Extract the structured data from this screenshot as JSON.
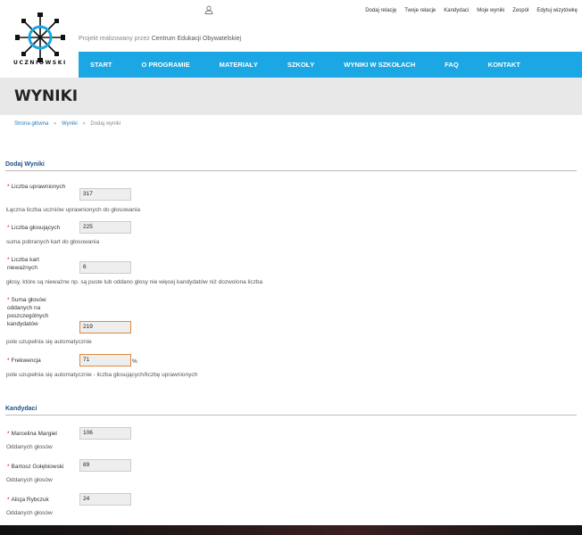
{
  "brand": {
    "logo_text": "UCZNIOWSKI",
    "tagline_prefix": "Projekt realizowany przez",
    "tagline_org": "Centrum Edukacji Obywatelskiej"
  },
  "top_links": [
    "Dodaj relację",
    "Twoje relacje",
    "Kandydaci",
    "Moje wyniki",
    "Zespół",
    "Edytuj wizytówkę"
  ],
  "nav": [
    "START",
    "O PROGRAMIE",
    "MATERIAŁY",
    "SZKOŁY",
    "WYNIKI W SZKOŁACH",
    "FAQ",
    "KONTAKT"
  ],
  "page_title": "WYNIKI",
  "breadcrumb": {
    "items": [
      "Strona główna",
      "Wyniki"
    ],
    "current": "Dodaj wyniki",
    "sep": "»"
  },
  "form": {
    "section_title": "Dodaj Wyniki",
    "fields": [
      {
        "label": "Liczba uprawnionych",
        "value": "317",
        "help": "Łączna liczba uczniów uprawnionych do głosowania"
      },
      {
        "label": "Liczba głosujących",
        "value": "225",
        "help": "suma pobranych kart do głosowania"
      },
      {
        "label": "Liczba kart nieważnych",
        "value": "6",
        "help": "głosy, które są nieważne np. są puste lub oddano głosy nie więcej kandydatów niż dozwolona liczba"
      },
      {
        "label": "Suma głosów oddanych na poszczególnych kandydatów",
        "value": "219",
        "help": "pole uzupełnia się automatycznie"
      },
      {
        "label": "Frekwencja",
        "value": "71",
        "unit": "%",
        "help": "pole uzupełnia się automatycznie - liczba głosujących/liczbę uprawnionych"
      }
    ]
  },
  "candidates": {
    "section_title": "Kandydaci",
    "items": [
      {
        "name": "Marcelina Margiel",
        "value": "106",
        "help": "Oddanych głosów"
      },
      {
        "name": "Bartosz Gołębiowski",
        "value": "89",
        "help": "Oddanych głosów"
      },
      {
        "name": "Alicja Rybczuk",
        "value": "24",
        "help": "Oddanych głosów"
      }
    ]
  },
  "required_mark": "*"
}
